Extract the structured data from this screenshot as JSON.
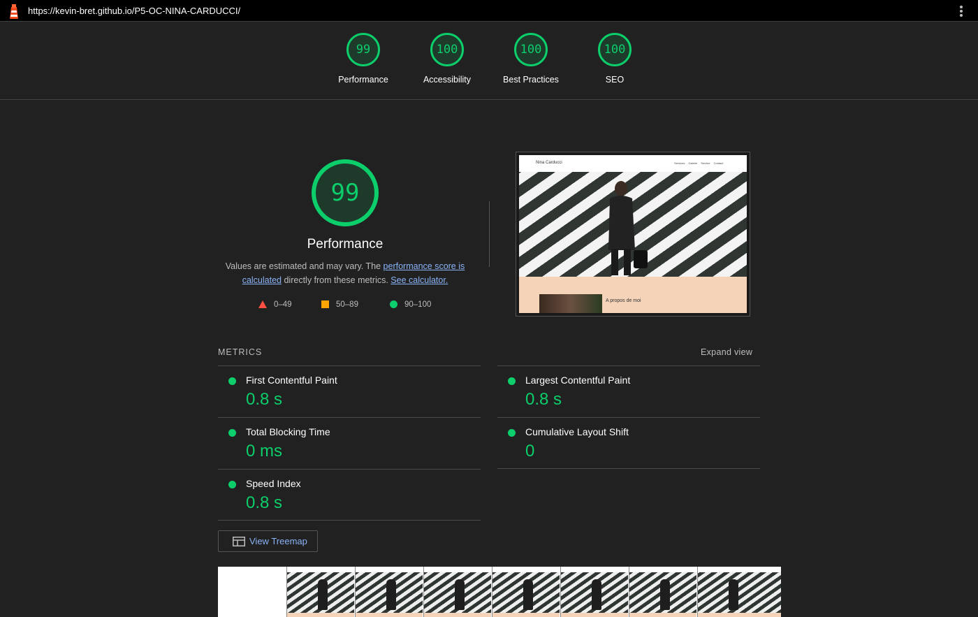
{
  "topbar": {
    "url": "https://kevin-bret.github.io/P5-OC-NINA-CARDUCCI/"
  },
  "scores": [
    {
      "label": "Performance",
      "value": "99"
    },
    {
      "label": "Accessibility",
      "value": "100"
    },
    {
      "label": "Best Practices",
      "value": "100"
    },
    {
      "label": "SEO",
      "value": "100"
    }
  ],
  "performance": {
    "score": "99",
    "title": "Performance",
    "desc_prefix": "Values are estimated and may vary. The ",
    "desc_link1": "performance score is calculated",
    "desc_middle": " directly from these metrics. ",
    "desc_link2": "See calculator.",
    "legend": {
      "fail": "0–49",
      "average": "50–89",
      "pass": "90–100"
    }
  },
  "screenshot": {
    "brand": "Nina Carducci",
    "links": [
      "Services",
      "Galerie",
      "Service",
      "Contact"
    ],
    "about_text": "A propos de moi"
  },
  "metrics": {
    "header": "METRICS",
    "expand": "Expand view",
    "items": [
      {
        "name": "First Contentful Paint",
        "value": "0.8 s"
      },
      {
        "name": "Largest Contentful Paint",
        "value": "0.8 s"
      },
      {
        "name": "Total Blocking Time",
        "value": "0 ms"
      },
      {
        "name": "Cumulative Layout Shift",
        "value": "0"
      },
      {
        "name": "Speed Index",
        "value": "0.8 s"
      }
    ]
  },
  "treemap": {
    "label": "View Treemap"
  },
  "colors": {
    "pass": "#0cce6b",
    "average": "#ffa400",
    "fail": "#ff4e42",
    "link": "#8ab4f8",
    "background": "#212121"
  }
}
